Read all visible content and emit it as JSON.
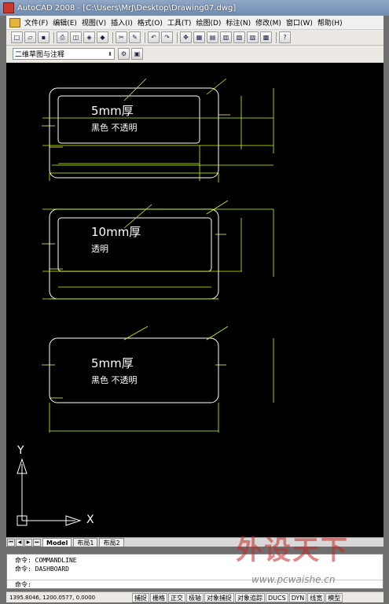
{
  "window": {
    "title": "AutoCAD 2008 - [C:\\Users\\MrJ\\Desktop\\Drawing07.dwg]"
  },
  "menubar": {
    "items": [
      "文件(F)",
      "编辑(E)",
      "视图(V)",
      "插入(I)",
      "格式(O)",
      "工具(T)",
      "绘图(D)",
      "标注(N)",
      "修改(M)",
      "窗口(W)",
      "帮助(H)"
    ]
  },
  "workspace": {
    "selected": "二维草图与注释"
  },
  "drawing": {
    "panels": [
      {
        "thickness": "5mm厚",
        "material": "黑色  不透明"
      },
      {
        "thickness": "10mm厚",
        "material": "透明"
      },
      {
        "thickness": "5mm厚",
        "material": "黑色  不透明"
      }
    ],
    "colors": {
      "background": "#000000",
      "geometry": "#ffffff",
      "dimensions": "#c8ff00"
    },
    "ucs": {
      "x_label": "X",
      "y_label": "Y"
    }
  },
  "layout_tabs": [
    "Model",
    "布局1",
    "布局2"
  ],
  "command": {
    "history": [
      "命令: COMMANDLINE",
      "命令: DASHBOARD"
    ],
    "prompt": "命令:"
  },
  "status": {
    "coordinates": "1395.8046, 1200.0577, 0.0000",
    "toggles": [
      "捕捉",
      "栅格",
      "正交",
      "极轴",
      "对象捕捉",
      "对象追踪",
      "DUCS",
      "DYN",
      "线宽",
      "模型"
    ]
  },
  "watermark": {
    "brand": "外设天下",
    "url": "www.pcwaishe.cn"
  }
}
